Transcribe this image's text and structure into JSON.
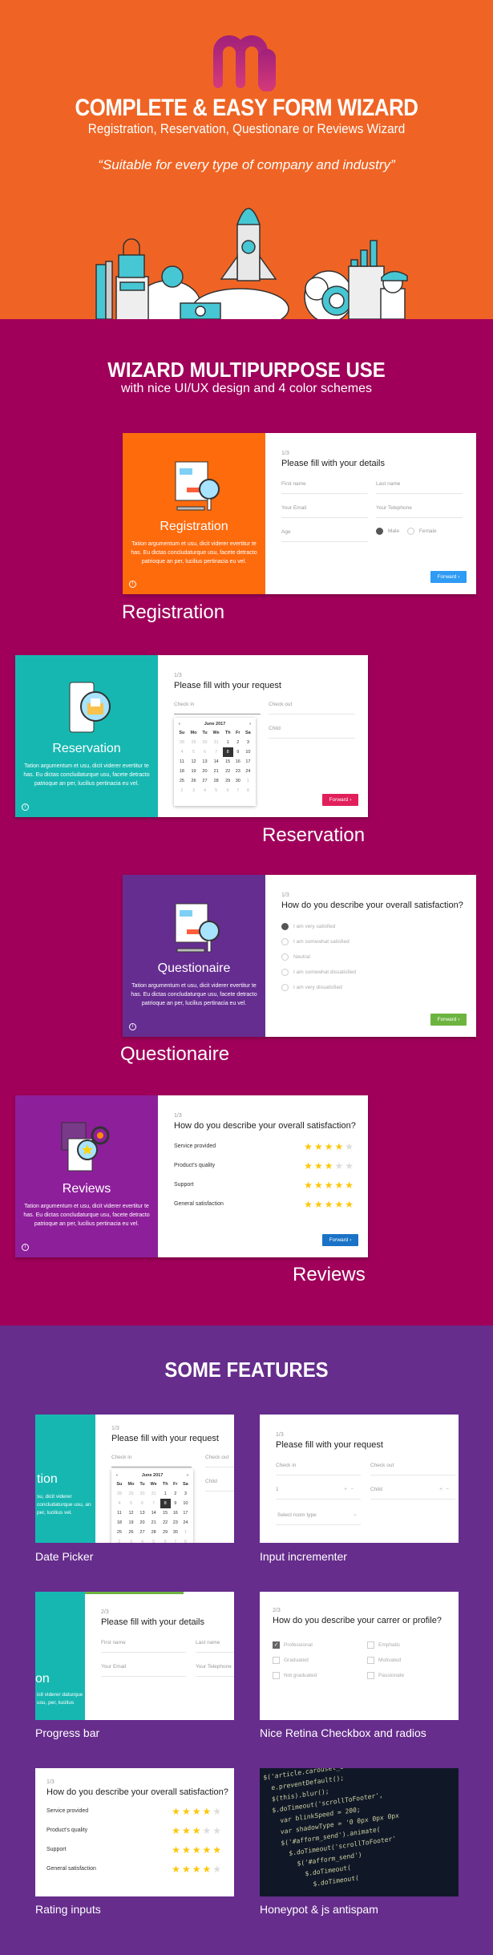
{
  "hero": {
    "title": "COMPLETE & EASY FORM WIZARD",
    "subtitle": "Registration, Reservation, Questionare or Reviews Wizard",
    "quote": "“Suitable for every type of company and industry”",
    "colors": {
      "bg": "#ef6424",
      "accent": "#47c6d4"
    }
  },
  "multipurpose": {
    "title": "WIZARD MULTIPURPOSE USE",
    "subtitle": "with nice UI/UX design and 4 color schemes",
    "bg": "#a0005a",
    "lorem": "Tation argumentum et usu, dicit viderer evertitur te has. Eu dictas concludaturque usu, facete detracto patrioque an per, lucilius pertinacia eu vel.",
    "registration": {
      "caption": "Registration",
      "panel_title": "Registration",
      "color": "#fd6b0d",
      "step": "1/3",
      "question": "Please fill with your details",
      "fields": [
        "First name",
        "Last name",
        "Your Email",
        "Your Telephone",
        "Age"
      ],
      "gender": [
        "Male",
        "Female"
      ],
      "gender_selected": "Male",
      "button": "Forward",
      "button_color": "#2f9bf4"
    },
    "reservation": {
      "caption": "Reservation",
      "panel_title": "Reservation",
      "color": "#17b7b1",
      "step": "1/3",
      "question": "Please fill with your request",
      "fields": [
        "Check in",
        "Check out",
        "Child"
      ],
      "calendar": {
        "month": "June 2017",
        "weekdays": [
          "Su",
          "Mo",
          "Tu",
          "We",
          "Th",
          "Fr",
          "Sa"
        ],
        "weeks": [
          [
            "28",
            "29",
            "30",
            "31",
            "1",
            "2",
            "3"
          ],
          [
            "4",
            "5",
            "6",
            "7",
            "8",
            "9",
            "10"
          ],
          [
            "11",
            "12",
            "13",
            "14",
            "15",
            "16",
            "17"
          ],
          [
            "18",
            "19",
            "20",
            "21",
            "22",
            "23",
            "24"
          ],
          [
            "25",
            "26",
            "27",
            "28",
            "29",
            "30",
            "1"
          ],
          [
            "2",
            "3",
            "4",
            "5",
            "6",
            "7",
            "8"
          ]
        ],
        "selected": "8"
      },
      "button": "Forward",
      "button_color": "#e01f5b"
    },
    "questionaire": {
      "caption": "Questionaire",
      "panel_title": "Questionaire",
      "color": "#662d91",
      "step": "1/3",
      "question": "How do you describe your overall satisfaction?",
      "options": [
        "I am very satisfied",
        "I am somewhat satisfied",
        "Neutral",
        "I am somewhat dissatisfied",
        "I am very dissatisfied"
      ],
      "selected": "I am very satisfied",
      "button": "Forward",
      "button_color": "#6cb33f"
    },
    "reviews": {
      "caption": "Reviews",
      "panel_title": "Reviews",
      "color": "#8e1f9b",
      "step": "1/3",
      "question": "How do you describe your overall satisfaction?",
      "ratings": [
        {
          "label": "Service provided",
          "value": 4,
          "max": 5
        },
        {
          "label": "Product's quality",
          "value": 3,
          "max": 5
        },
        {
          "label": "Support",
          "value": 5,
          "max": 5
        },
        {
          "label": "General satisfaction",
          "value": 5,
          "max": 5
        }
      ],
      "button": "Forward",
      "button_color": "#1a73c6"
    }
  },
  "features": {
    "title": "SOME FEATURES",
    "bg": "#662d8c",
    "items": [
      {
        "label": "Date Picker",
        "step": "1/3",
        "question": "Please fill with your request",
        "fields": [
          "Check in",
          "Check out",
          "Child"
        ],
        "panel_title": "tion",
        "panel_desc": "su, dicit viderer concludaturque usu, an per, lucilius vel."
      },
      {
        "label": "Input incrementer",
        "step": "1/3",
        "question": "Please fill with your request",
        "fields": [
          "Check in",
          "Check out",
          "1",
          "Child",
          "Select room type"
        ]
      },
      {
        "label": "Progress bar",
        "step": "2/3",
        "question": "Please fill with your details",
        "fields": [
          "First name",
          "Last name",
          "Your Email",
          "Your Telephone"
        ],
        "progress": 0.66,
        "panel_title": "on",
        "panel_desc": "icit viderer daturque usu, per, lucilius"
      },
      {
        "label": "Nice Retina Checkbox and radios",
        "step": "2/3",
        "question": "How do you describe your carrer or profile?",
        "checkboxes": [
          {
            "label": "Professional",
            "checked": true
          },
          {
            "label": "Emphatic",
            "checked": false
          },
          {
            "label": "Graduated",
            "checked": false
          },
          {
            "label": "Motivated",
            "checked": false
          },
          {
            "label": "Not graduated",
            "checked": false
          },
          {
            "label": "Passionate",
            "checked": false
          }
        ]
      },
      {
        "label": "Rating inputs",
        "step": "1/3",
        "question": "How do you describe your overall satisfaction?",
        "ratings": [
          {
            "label": "Service provided",
            "value": 4
          },
          {
            "label": "Product's quality",
            "value": 3
          },
          {
            "label": "Support",
            "value": 5
          },
          {
            "label": "General satisfaction",
            "value": 4
          }
        ]
      },
      {
        "label": "Honeypot & js antispam",
        "code": "$('article.carousel_item a').\n  e.preventDefault();\n  $(this).blur();\n  $.doTimeout('scrollToFooter',\n    var blinkSpeed = 200;\n    var shadowType = '0 0px 0px 0px\n    $('#afform_send').animate(\n      $.doTimeout('scrollToFooter'\n        $('#afform_send')\n          $.doTimeout(\n            $.doTimeout("
      }
    ]
  }
}
